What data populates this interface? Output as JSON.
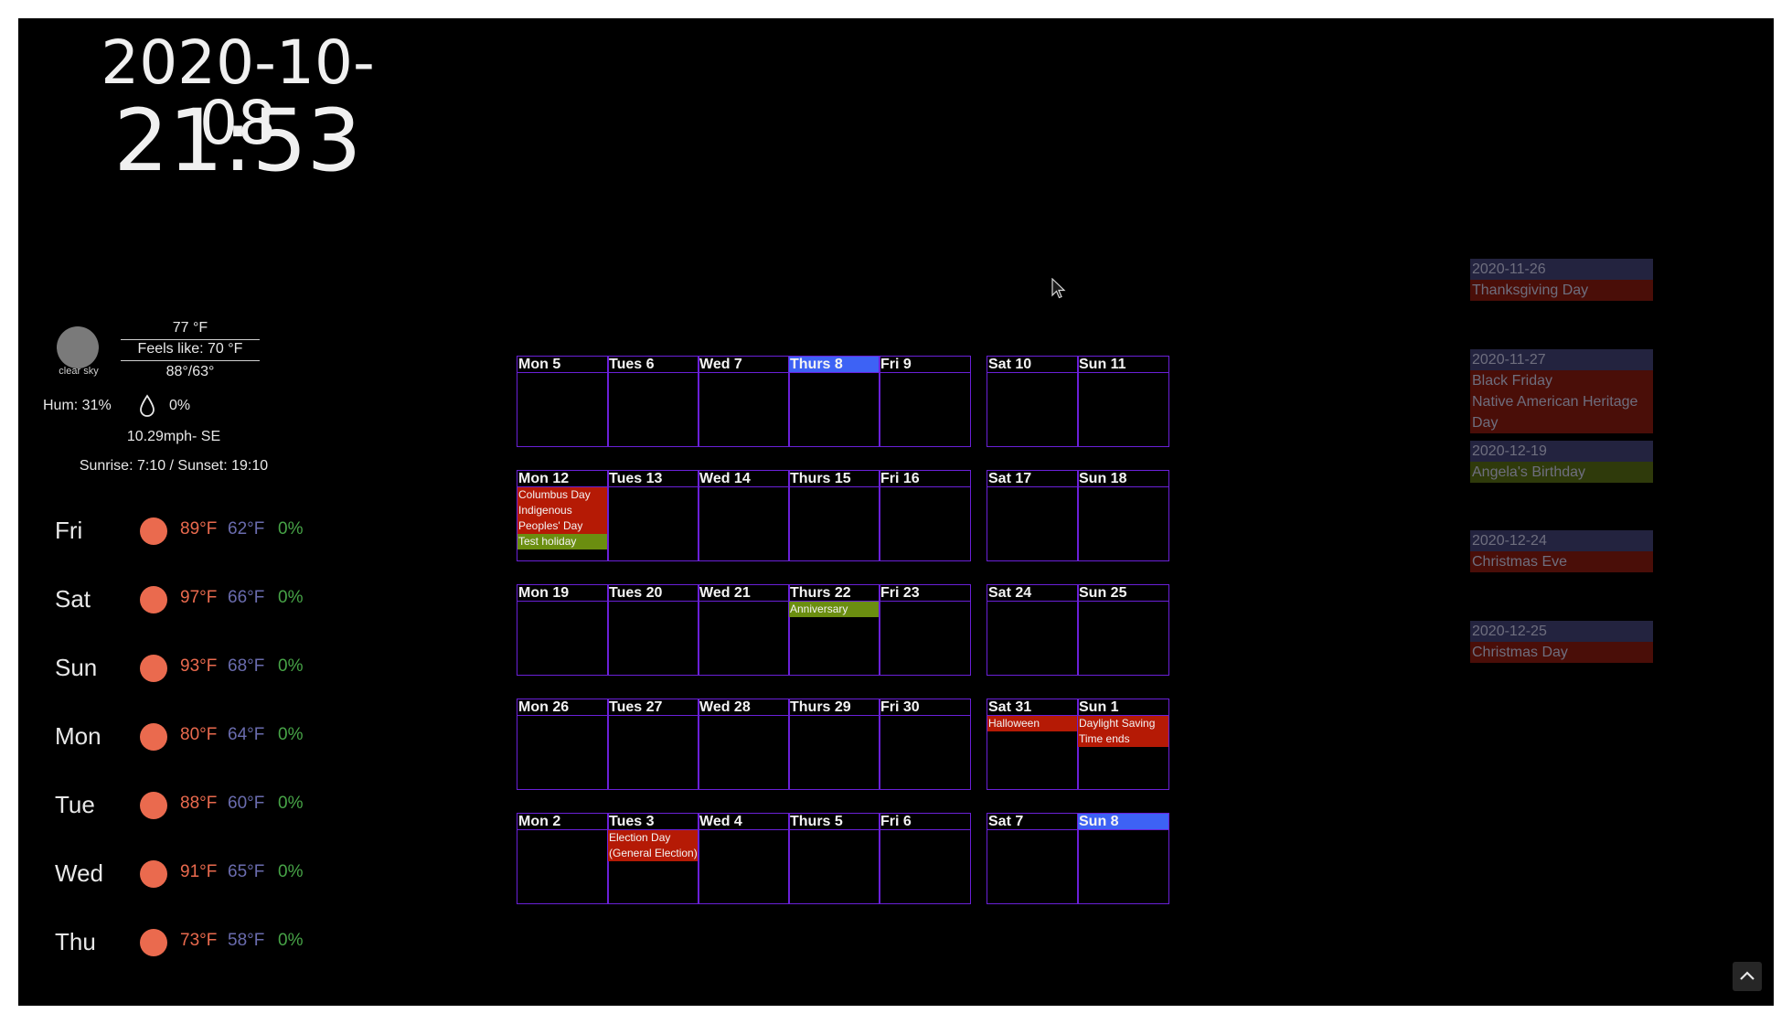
{
  "clock": {
    "date": "2020-10-08",
    "time": "21:53"
  },
  "weather": {
    "current": {
      "description": "clear sky",
      "temp": "77 °F",
      "feels_like": "Feels like: 70 °F",
      "hi_lo": "88°/63°",
      "humidity": "Hum: 31%",
      "precip": "0%",
      "wind": "10.29mph- SE",
      "sunrise_sunset": "Sunrise: 7:10 / Sunset: 19:10",
      "icon": "moon-icon"
    },
    "forecast": [
      {
        "day": "Fri",
        "hi": "89°F",
        "lo": "62°F",
        "pop": "0%"
      },
      {
        "day": "Sat",
        "hi": "97°F",
        "lo": "66°F",
        "pop": "0%"
      },
      {
        "day": "Sun",
        "hi": "93°F",
        "lo": "68°F",
        "pop": "0%"
      },
      {
        "day": "Mon",
        "hi": "80°F",
        "lo": "64°F",
        "pop": "0%"
      },
      {
        "day": "Tue",
        "hi": "88°F",
        "lo": "60°F",
        "pop": "0%"
      },
      {
        "day": "Wed",
        "hi": "91°F",
        "lo": "65°F",
        "pop": "0%"
      },
      {
        "day": "Thu",
        "hi": "73°F",
        "lo": "58°F",
        "pop": "0%"
      }
    ],
    "colors": {
      "sun": "#ea6a4e",
      "hi": "#ea6a4e",
      "lo": "#6a6cae",
      "pop": "#47a447"
    }
  },
  "calendar": {
    "colors": {
      "border": "#6a20d8",
      "today": "#3d62f5",
      "holiday": "#b51a05",
      "personal": "#6b8e10"
    },
    "weeks": [
      {
        "days": [
          {
            "label": "Mon 5",
            "events": []
          },
          {
            "label": "Tues 6",
            "events": []
          },
          {
            "label": "Wed 7",
            "events": []
          },
          {
            "label": "Thurs 8",
            "today": true,
            "events": []
          },
          {
            "label": "Fri 9",
            "events": []
          },
          {
            "label": "Sat 10",
            "events": []
          },
          {
            "label": "Sun 11",
            "events": []
          }
        ]
      },
      {
        "days": [
          {
            "label": "Mon 12",
            "events": [
              {
                "title": "Columbus Day",
                "type": "red"
              },
              {
                "title": "Indigenous Peoples' Day",
                "type": "red"
              },
              {
                "title": "Test holiday",
                "type": "olive"
              }
            ]
          },
          {
            "label": "Tues 13",
            "events": []
          },
          {
            "label": "Wed 14",
            "events": []
          },
          {
            "label": "Thurs 15",
            "events": []
          },
          {
            "label": "Fri 16",
            "events": []
          },
          {
            "label": "Sat 17",
            "events": []
          },
          {
            "label": "Sun 18",
            "events": []
          }
        ]
      },
      {
        "days": [
          {
            "label": "Mon 19",
            "events": []
          },
          {
            "label": "Tues 20",
            "events": []
          },
          {
            "label": "Wed 21",
            "events": []
          },
          {
            "label": "Thurs 22",
            "events": [
              {
                "title": "Anniversary",
                "type": "olive"
              }
            ]
          },
          {
            "label": "Fri 23",
            "events": []
          },
          {
            "label": "Sat 24",
            "events": []
          },
          {
            "label": "Sun 25",
            "events": []
          }
        ]
      },
      {
        "days": [
          {
            "label": "Mon 26",
            "events": []
          },
          {
            "label": "Tues 27",
            "events": []
          },
          {
            "label": "Wed 28",
            "events": []
          },
          {
            "label": "Thurs 29",
            "events": []
          },
          {
            "label": "Fri 30",
            "events": []
          },
          {
            "label": "Sat 31",
            "events": [
              {
                "title": "Halloween",
                "type": "red"
              }
            ]
          },
          {
            "label": "Sun 1",
            "events": [
              {
                "title": "Daylight Saving Time ends",
                "type": "red"
              }
            ]
          }
        ]
      },
      {
        "days": [
          {
            "label": "Mon 2",
            "events": []
          },
          {
            "label": "Tues 3",
            "events": [
              {
                "title": "Election Day (General Election)",
                "type": "red"
              }
            ]
          },
          {
            "label": "Wed 4",
            "events": []
          },
          {
            "label": "Thurs 5",
            "events": []
          },
          {
            "label": "Fri 6",
            "events": []
          },
          {
            "label": "Sat 7",
            "events": []
          },
          {
            "label": "Sun 8",
            "today": true,
            "events": []
          }
        ]
      }
    ]
  },
  "upcoming": [
    {
      "date": "2020-11-26",
      "titles": [
        {
          "title": "Thanksgiving Day",
          "type": "red"
        }
      ]
    },
    {
      "date": "2020-11-27",
      "titles": [
        {
          "title": "Black Friday",
          "type": "red"
        },
        {
          "title": "Native American Heritage Day",
          "type": "red"
        }
      ]
    },
    {
      "date": "2020-12-19",
      "titles": [
        {
          "title": "Angela's Birthday",
          "type": "olive"
        }
      ]
    },
    {
      "date": "2020-12-24",
      "titles": [
        {
          "title": "Christmas Eve",
          "type": "red"
        }
      ]
    },
    {
      "date": "2020-12-25",
      "titles": [
        {
          "title": "Christmas Day",
          "type": "red"
        }
      ]
    }
  ]
}
